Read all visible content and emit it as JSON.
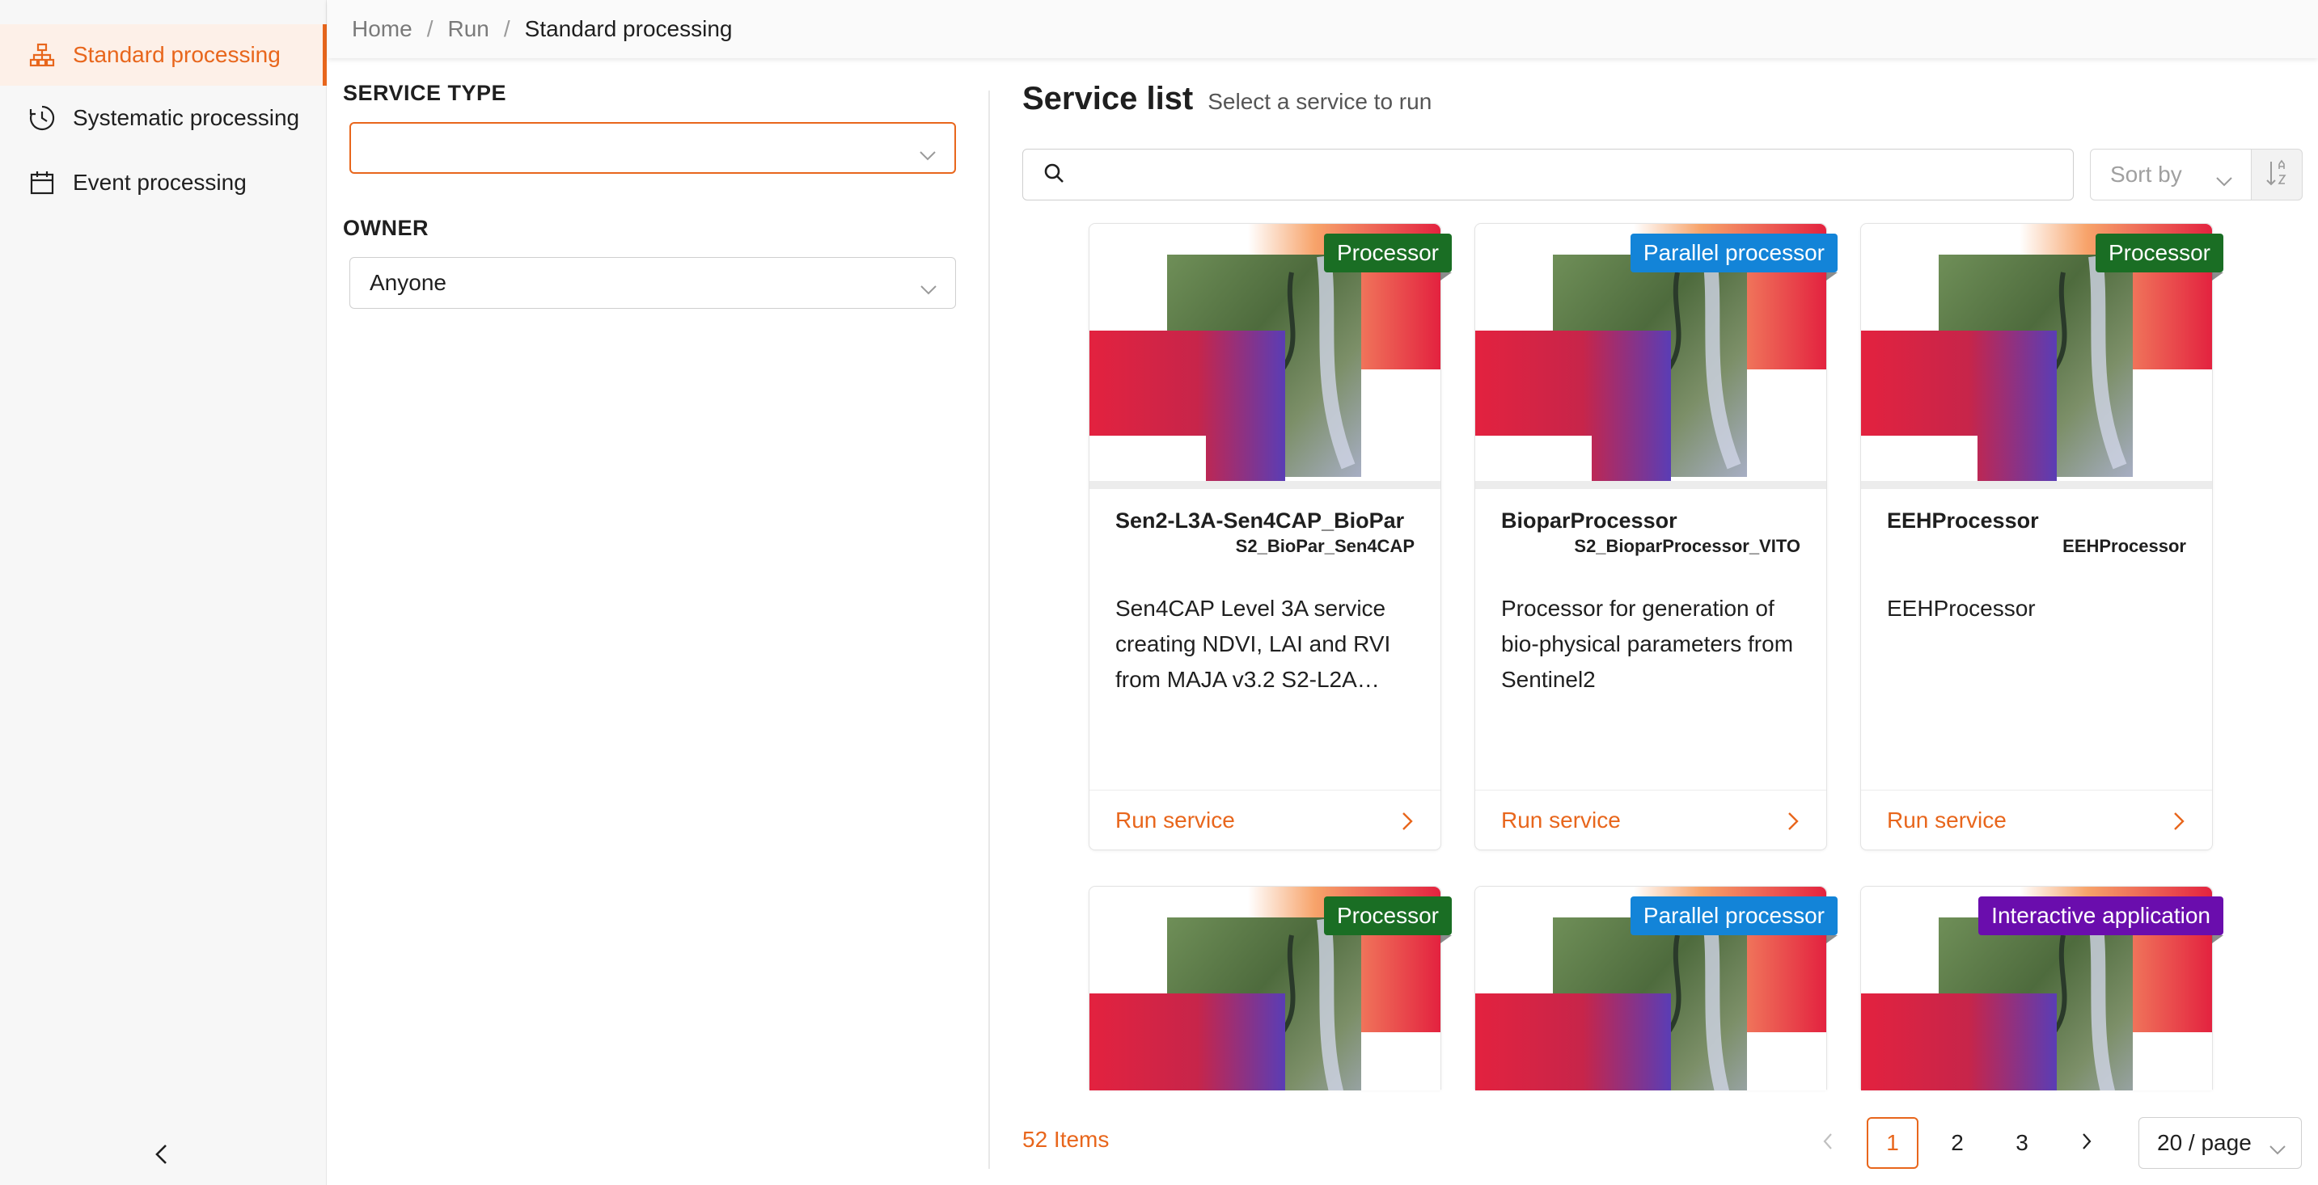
{
  "sidebar": {
    "items": [
      {
        "label": "Standard processing",
        "icon": "sitemap-icon",
        "active": true
      },
      {
        "label": "Systematic processing",
        "icon": "clock-icon",
        "active": false
      },
      {
        "label": "Event processing",
        "icon": "calendar-icon",
        "active": false
      }
    ],
    "collapse_icon": "chevron-left-icon"
  },
  "breadcrumb": {
    "items": [
      "Home",
      "Run",
      "Standard processing"
    ],
    "separator": "/"
  },
  "filters": {
    "service_type": {
      "label": "SERVICE TYPE",
      "value": ""
    },
    "owner": {
      "label": "OWNER",
      "value": "Anyone"
    }
  },
  "service_list": {
    "title": "Service list",
    "subtitle": "Select a service to run",
    "search_placeholder": "",
    "sort_by_placeholder": "Sort by"
  },
  "cards": [
    {
      "tag": "Processor",
      "tag_type": "processor",
      "name": "Sen2-L3A-Sen4CAP_BioPar",
      "id": "S2_BioPar_Sen4CAP",
      "description": "Sen4CAP Level 3A service creating NDVI, LAI and RVI from MAJA v3.2 S2-L2A…",
      "action": "Run service"
    },
    {
      "tag": "Parallel processor",
      "tag_type": "parallel",
      "name": "BioparProcessor",
      "id": "S2_BioparProcessor_VITO",
      "description": "Processor for generation of bio-physical parameters from Sentinel2",
      "action": "Run service"
    },
    {
      "tag": "Processor",
      "tag_type": "processor",
      "name": "EEHProcessor",
      "id": "EEHProcessor",
      "description": "EEHProcessor",
      "action": "Run service"
    },
    {
      "tag": "Processor",
      "tag_type": "processor"
    },
    {
      "tag": "Parallel processor",
      "tag_type": "parallel"
    },
    {
      "tag": "Interactive application",
      "tag_type": "interactive"
    }
  ],
  "pagination": {
    "total": "52 Items",
    "pages": [
      "1",
      "2",
      "3"
    ],
    "current": "1",
    "page_size": "20 / page"
  },
  "colors": {
    "accent": "#e8661c",
    "processor_tag": "#1a6e24",
    "parallel_tag": "#1384d8",
    "interactive_tag": "#6a0dad"
  }
}
